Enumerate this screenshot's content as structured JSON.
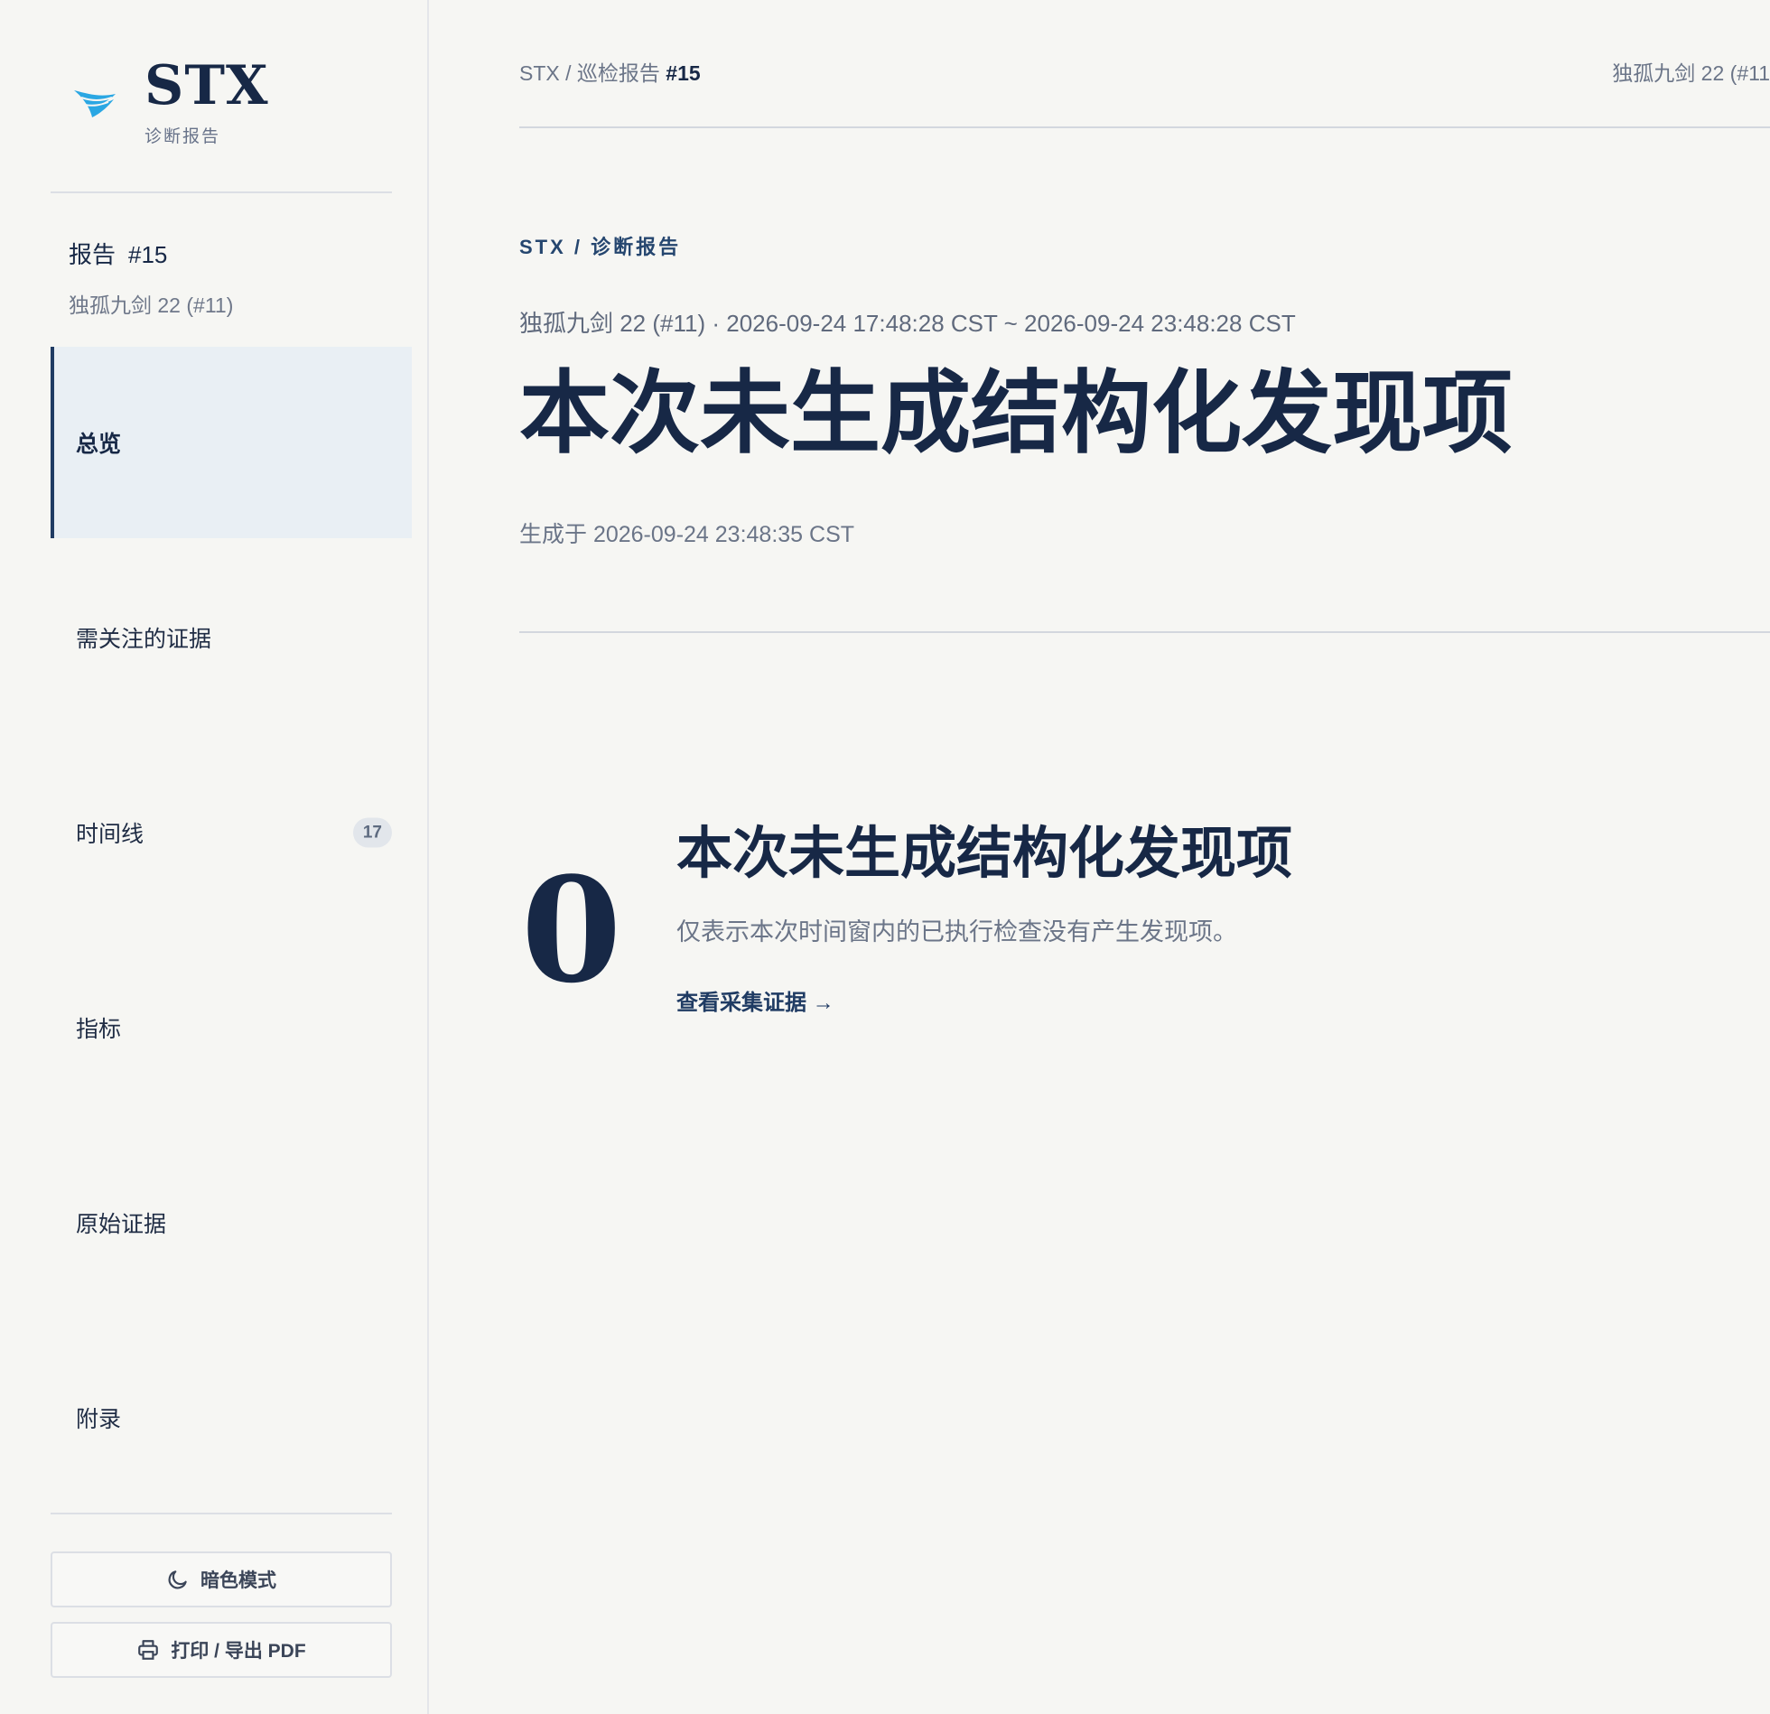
{
  "brand": {
    "name": "STX",
    "subtitle": "诊断报告"
  },
  "report": {
    "label": "报告",
    "number": "#15",
    "subtitle": "独孤九剑 22 (#11)"
  },
  "nav": {
    "overview": "总览",
    "evidence_attention": "需关注的证据",
    "timeline": "时间线",
    "timeline_badge": "17",
    "metrics": "指标",
    "raw_evidence": "原始证据",
    "appendix": "附录"
  },
  "buttons": {
    "dark_mode": "暗色模式",
    "print_pdf": "打印 / 导出 PDF"
  },
  "topbar": {
    "crumb_prefix": "STX / 巡检报告 ",
    "crumb_num": "#15",
    "right": "独孤九剑 22 (#11"
  },
  "header": {
    "eyebrow": "STX / 诊断报告",
    "window": "独孤九剑 22 (#11) · 2026-09-24 17:48:28 CST ~ 2026-09-24 23:48:28 CST",
    "title": "本次未生成结构化发现项",
    "generated": "生成于 2026-09-24 23:48:35 CST"
  },
  "summary": {
    "count": "0",
    "title": "本次未生成结构化发现项",
    "description": "仅表示本次时间窗内的已执行检查没有产生发现项。",
    "link": "查看采集证据 →"
  },
  "colors": {
    "accent": "#1f3b63",
    "active_bg": "#e9eff4",
    "logo_blue": "#2aa7e3"
  }
}
